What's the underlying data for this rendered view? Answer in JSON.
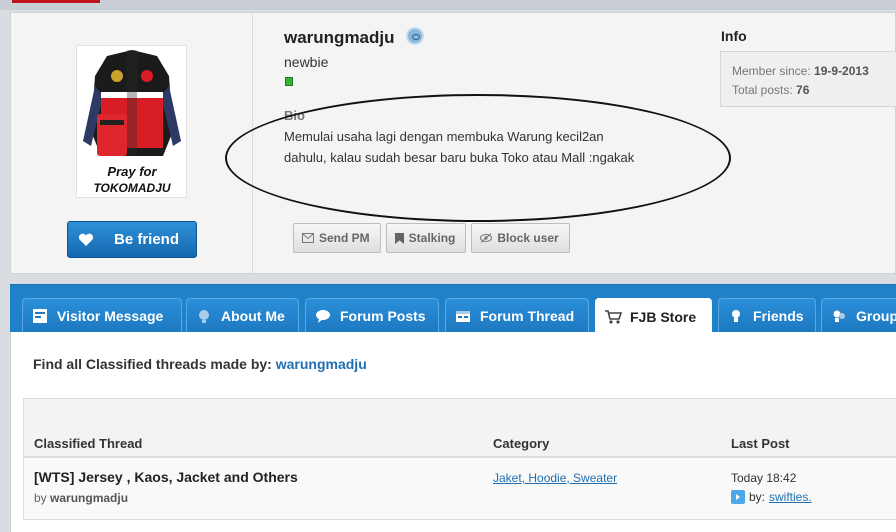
{
  "profile": {
    "username": "warungmadju",
    "rank": "newbie",
    "bio_label": "Bio",
    "bio_line1": "Memulai usaha lagi dengan membuka Warung kecil2an",
    "bio_line2": "dahulu, kalau sudah besar baru buka Toko atau Mall :ngakak",
    "avatar_caption_1": "Pray for",
    "avatar_caption_2": "TOKOMADJU",
    "be_friend_label": "Be friend",
    "actions": {
      "send_pm": "Send PM",
      "stalking": "Stalking",
      "block_user": "Block user"
    },
    "info": {
      "title": "Info",
      "member_since_label": "Member since:",
      "member_since_value": "19-9-2013",
      "total_posts_label": "Total posts:",
      "total_posts_value": "76"
    }
  },
  "tabs": [
    {
      "label": "Visitor Message",
      "icon": "message-icon"
    },
    {
      "label": "About Me",
      "icon": "about-icon"
    },
    {
      "label": "Forum Posts",
      "icon": "chat-bubble-icon"
    },
    {
      "label": "Forum Thread",
      "icon": "thread-icon"
    },
    {
      "label": "FJB Store",
      "icon": "cart-icon",
      "active": true
    },
    {
      "label": "Friends",
      "icon": "friends-icon"
    },
    {
      "label": "Group",
      "icon": "group-icon"
    }
  ],
  "content": {
    "find_label": "Find all Classified threads made by:",
    "find_user": "warungmadju",
    "columns": {
      "thread": "Classified Thread",
      "category": "Category",
      "last_post": "Last Post"
    },
    "rows": [
      {
        "title": "[WTS] Jersey , Kaos, Jacket and Others",
        "by_label": "by",
        "author": "warungmadju",
        "category": "Jaket, Hoodie, Sweater",
        "last_time": "Today 18:42",
        "last_by_label": "by:",
        "last_user": "swifties."
      }
    ]
  },
  "colors": {
    "tab_bar": "#1f82c9",
    "button_blue": "#1469b0",
    "link": "#1f6fb2",
    "online": "#35b233"
  }
}
